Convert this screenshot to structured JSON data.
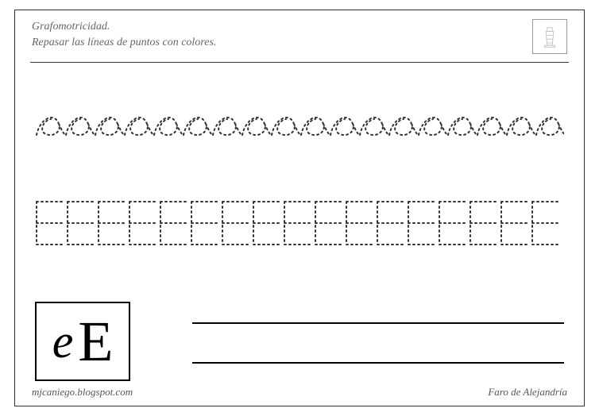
{
  "header": {
    "title_line1": "Grafomotricidad.",
    "title_line2": "Repasar las líneas de puntos con colores."
  },
  "tracing": {
    "row1_letter": "e",
    "row1_count": 18,
    "row2_letter": "E",
    "row2_count": 17
  },
  "sample": {
    "lowercase": "e",
    "uppercase": "E"
  },
  "footer": {
    "left": "mjcaniego.blogspot.com",
    "right": "Faro de Alejandría"
  }
}
